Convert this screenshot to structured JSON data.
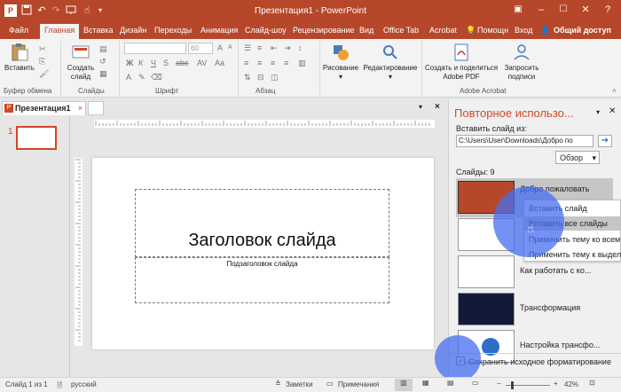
{
  "titlebar": {
    "title": "Презентация1 - PowerPoint",
    "help_icon": "?",
    "win_icons": [
      "restore-ribbon-icon",
      "minimize-icon",
      "maximize-icon",
      "close-icon"
    ]
  },
  "ribbon_tabs": {
    "items": [
      "Файл",
      "Главная",
      "Вставка",
      "Дизайн",
      "Переходы",
      "Анимация",
      "Слайд-шоу",
      "Рецензирование",
      "Вид",
      "Office Tab",
      "Acrobat"
    ],
    "active": "Главная",
    "help": "Помощн",
    "signin": "Вход",
    "share": "Общий доступ"
  },
  "ribbon": {
    "paste": "Вставить",
    "new_slide_l1": "Создать",
    "new_slide_l2": "слайд",
    "font_size": "60",
    "drawing": "Рисование",
    "editing": "Редактирование",
    "create_share_l1": "Создать и поделиться",
    "create_share_l2": "Adobe PDF",
    "request_sign_l1": "Запросить",
    "request_sign_l2": "подписи",
    "groups": {
      "clipboard": "Буфер обмена",
      "slides": "Слайды",
      "font": "Шрифт",
      "paragraph": "Абзац",
      "acrobat": "Adobe Acrobat"
    }
  },
  "doc_tab": {
    "name": "Презентация1",
    "close": "×"
  },
  "thumbnails": {
    "slide_number": "1"
  },
  "slide": {
    "title": "Заголовок слайда",
    "subtitle": "Подзаголовок слайда"
  },
  "reuse_pane": {
    "title": "Повторное использо...",
    "insert_from_label": "Вставить слайд из:",
    "path_value": "C:\\Users\\User\\Downloads\\Добро по",
    "browse": "Обзор",
    "slides_count": "Слайды: 9",
    "items": [
      "Добро пожаловать",
      "",
      "Как работать с ко...",
      "Трансформация",
      "Настройка трансфо..."
    ],
    "keep_formatting": "Сохранить исходное форматирование",
    "keep_formatting_checked": true
  },
  "context_menu": {
    "items": [
      "Вставить слайд",
      "Вставить все слайды",
      "Применить тему ко всем с",
      "Применить тему к выделе"
    ],
    "highlighted_index": 1
  },
  "status": {
    "slide_info": "Слайд 1 из 1",
    "language": "русский",
    "notes": "Заметки",
    "comments": "Примечания",
    "zoom": "42%"
  },
  "colors": {
    "brand": "#b7472a",
    "accent_orange": "#d24726",
    "touch_circle": "#466ef0"
  }
}
